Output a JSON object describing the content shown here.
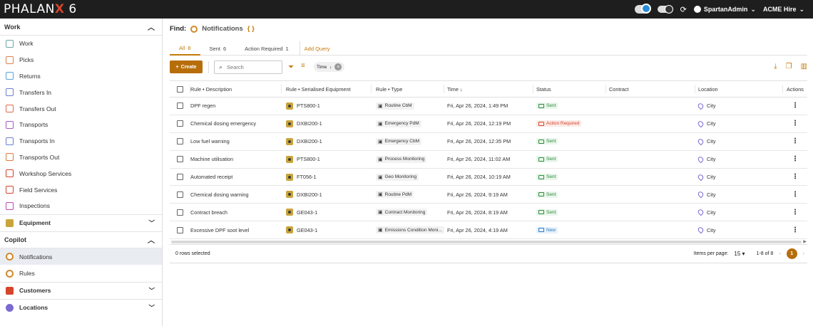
{
  "app": {
    "logo_left": "PHALAN",
    "logo_x": "X",
    "logo_right": " 6"
  },
  "topbar": {
    "user": "SpartanAdmin",
    "company": "ACME Hire"
  },
  "sidebar": {
    "work_header": "Work",
    "work_items": [
      {
        "label": "Work",
        "color": "#6aa7a7"
      },
      {
        "label": "Picks",
        "color": "#e0804f"
      },
      {
        "label": "Returns",
        "color": "#5aa2d6"
      },
      {
        "label": "Transfers In",
        "color": "#6c7fd1"
      },
      {
        "label": "Transfers Out",
        "color": "#e06a4f"
      },
      {
        "label": "Transports",
        "color": "#a45ac8"
      },
      {
        "label": "Transports In",
        "color": "#6c7fd1"
      },
      {
        "label": "Transports Out",
        "color": "#e07a3f"
      },
      {
        "label": "Workshop Services",
        "color": "#d4452c"
      },
      {
        "label": "Field Services",
        "color": "#d4452c"
      },
      {
        "label": "Inspections",
        "color": "#c046b8"
      }
    ],
    "equipment_header": "Equipment",
    "copilot_header": "Copilot",
    "copilot_items": [
      {
        "label": "Notifications",
        "color": "#d08a2a"
      },
      {
        "label": "Rules",
        "color": "#d08a2a"
      }
    ],
    "customers_header": "Customers",
    "locations_header": "Locations"
  },
  "find": {
    "label": "Find:",
    "title": "Notifications"
  },
  "tabs": [
    {
      "label": "All",
      "count": "8"
    },
    {
      "label": "Sent",
      "count": "6"
    },
    {
      "label": "Action Required",
      "count": "1"
    }
  ],
  "add_query": "Add Query",
  "toolbar": {
    "create": "Create",
    "search_placeholder": "Search",
    "chip": "Time"
  },
  "columns": {
    "rule_description": "Rule • Description",
    "serialised_equipment": "Rule • Serialised Equipment",
    "rule_type": "Rule • Type",
    "time": "Time",
    "status": "Status",
    "contract": "Contract",
    "location": "Location",
    "actions": "Actions"
  },
  "rows": [
    {
      "desc": "DPF regen",
      "equip": "PTS800-1",
      "type": "Routine CbM",
      "time": "Fri, Apr 26, 2024, 1:49 PM",
      "status": "Sent",
      "location": "City"
    },
    {
      "desc": "Chemical dosing emergency",
      "equip": "DXBI200-1",
      "type": "Emergency PdM",
      "time": "Fri, Apr 26, 2024, 12:19 PM",
      "status": "Action Required",
      "location": "City"
    },
    {
      "desc": "Low fuel warning",
      "equip": "DXBI200-1",
      "type": "Emergency CbM",
      "time": "Fri, Apr 26, 2024, 12:35 PM",
      "status": "Sent",
      "location": "City"
    },
    {
      "desc": "Machine utilisation",
      "equip": "PTS800-1",
      "type": "Process Monitoring",
      "time": "Fri, Apr 26, 2024, 11:02 AM",
      "status": "Sent",
      "location": "City"
    },
    {
      "desc": "Automated receipt",
      "equip": "FT056-1",
      "type": "Geo Monitoring",
      "time": "Fri, Apr 26, 2024, 10:19 AM",
      "status": "Sent",
      "location": "City"
    },
    {
      "desc": "Chemical dosing warning",
      "equip": "DXBI200-1",
      "type": "Routine PdM",
      "time": "Fri, Apr 26, 2024, 9:19 AM",
      "status": "Sent",
      "location": "City"
    },
    {
      "desc": "Contract breach",
      "equip": "GE043-1",
      "type": "Contract Monitoring",
      "time": "Fri, Apr 26, 2024, 8:19 AM",
      "status": "Sent",
      "location": "City"
    },
    {
      "desc": "Excessive DPF soot level",
      "equip": "GE043-1",
      "type": "Emissions Condition Moni...",
      "time": "Fri, Apr 26, 2024, 4:19 AM",
      "status": "New",
      "location": "City"
    }
  ],
  "footer": {
    "selected": "0 rows selected",
    "items_per_page_label": "Items per page:",
    "items_per_page": "15",
    "range": "1-8 of 8",
    "page": "1"
  }
}
